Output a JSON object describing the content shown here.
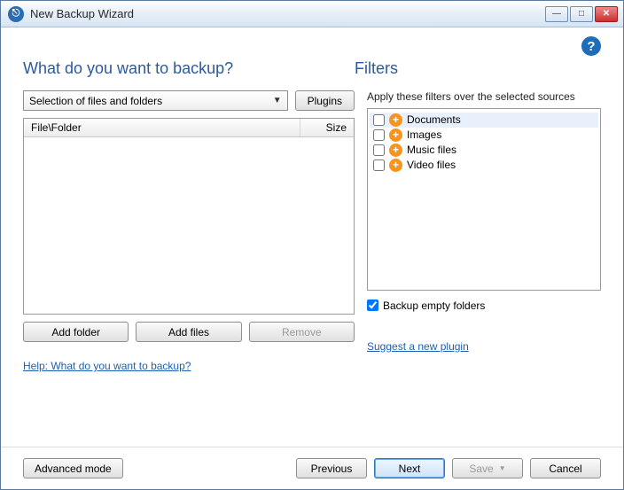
{
  "window": {
    "title": "New Backup Wizard"
  },
  "headings": {
    "left": "What do you want to backup?",
    "right": "Filters"
  },
  "source": {
    "dropdown_label": "Selection of files and folders",
    "plugins_btn": "Plugins"
  },
  "grid": {
    "col_file": "File\\Folder",
    "col_size": "Size"
  },
  "buttons": {
    "add_folder": "Add folder",
    "add_files": "Add files",
    "remove": "Remove"
  },
  "links": {
    "help": "Help: What do you want to backup?",
    "suggest": "Suggest a new plugin"
  },
  "filters": {
    "desc": "Apply these filters over the selected sources",
    "items": [
      {
        "label": "Documents"
      },
      {
        "label": "Images"
      },
      {
        "label": "Music files"
      },
      {
        "label": "Video files"
      }
    ],
    "backup_empty": "Backup empty folders",
    "backup_empty_checked": true
  },
  "footer": {
    "advanced": "Advanced mode",
    "previous": "Previous",
    "next": "Next",
    "save": "Save",
    "cancel": "Cancel"
  }
}
